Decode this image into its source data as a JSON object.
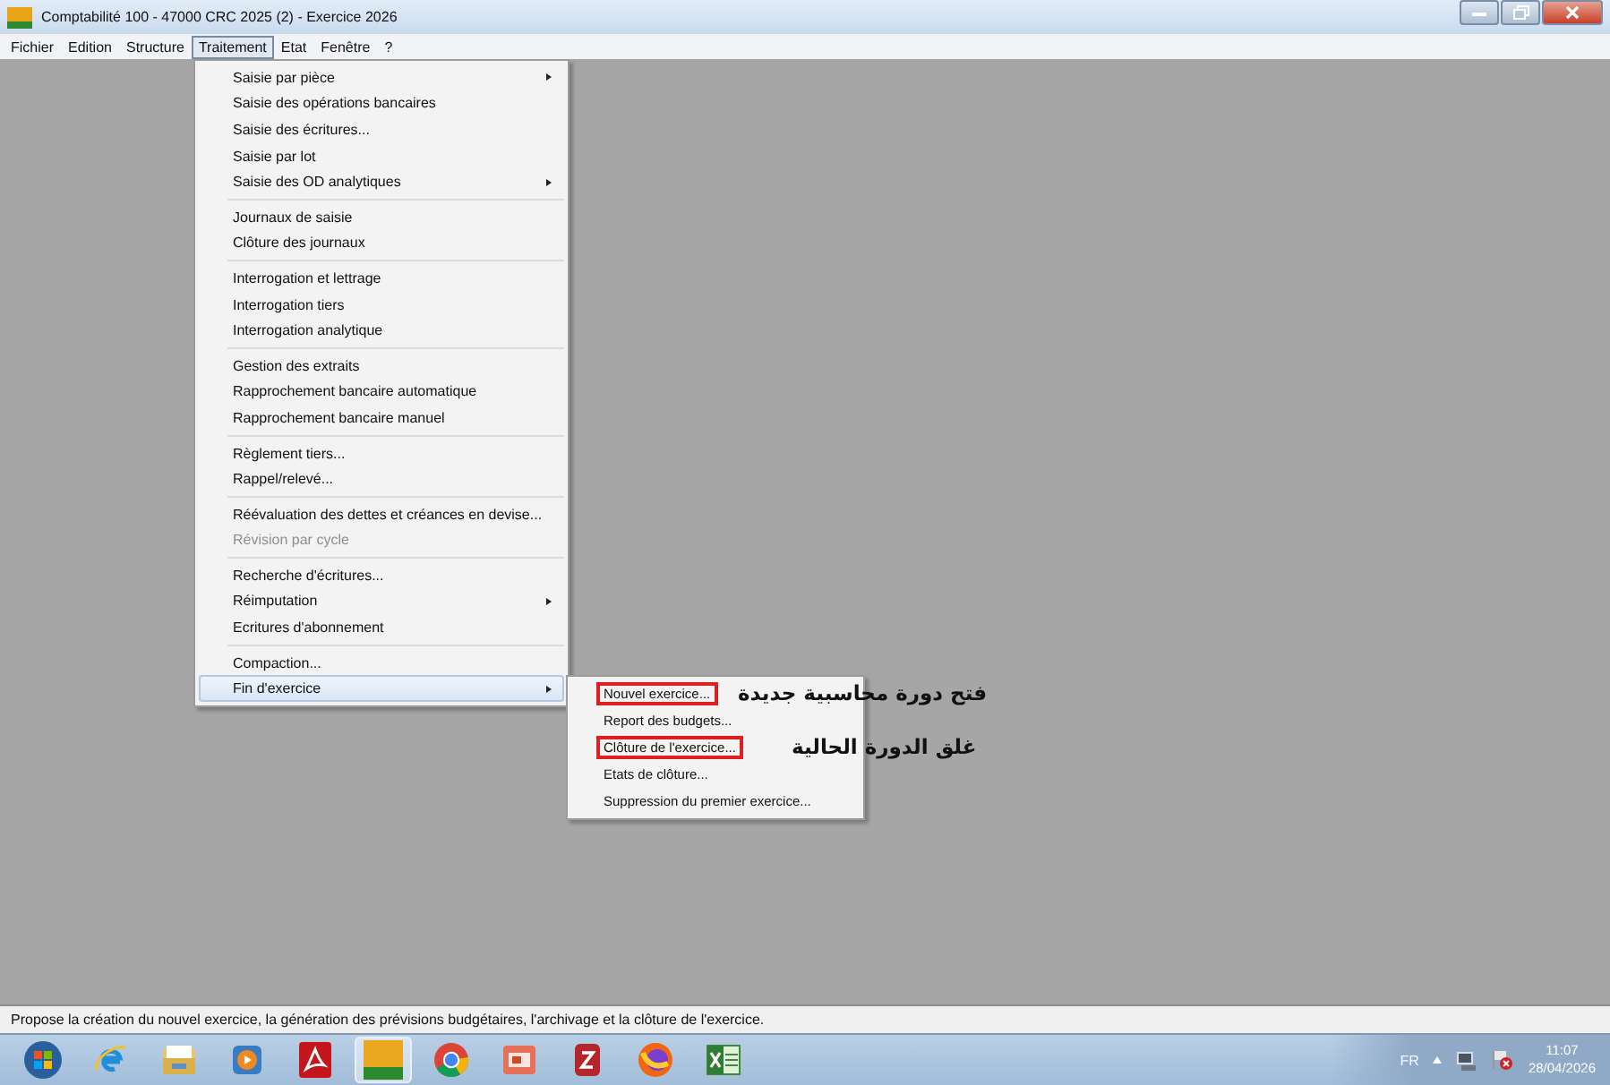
{
  "window": {
    "title": "Comptabilité 100 - 47000 CRC 2025 (2) - Exercice 2026"
  },
  "menubar": [
    {
      "label": "Fichier",
      "selected": false
    },
    {
      "label": "Edition",
      "selected": false
    },
    {
      "label": "Structure",
      "selected": false
    },
    {
      "label": "Traitement",
      "selected": true
    },
    {
      "label": "Etat",
      "selected": false
    },
    {
      "label": "Fenêtre",
      "selected": false
    },
    {
      "label": "?",
      "selected": false
    }
  ],
  "menu": [
    {
      "kind": "item",
      "label": "Saisie par pièce",
      "submenu": true,
      "disabled": false,
      "selected": false
    },
    {
      "kind": "item",
      "label": "Saisie des opérations bancaires",
      "submenu": false,
      "disabled": false,
      "selected": false
    },
    {
      "kind": "item",
      "label": "Saisie des écritures...",
      "submenu": false,
      "disabled": false,
      "selected": false
    },
    {
      "kind": "item",
      "label": "Saisie par lot",
      "submenu": false,
      "disabled": false,
      "selected": false
    },
    {
      "kind": "item",
      "label": "Saisie des OD analytiques",
      "submenu": true,
      "disabled": false,
      "selected": false
    },
    {
      "kind": "separator"
    },
    {
      "kind": "item",
      "label": "Journaux de saisie",
      "submenu": false,
      "disabled": false,
      "selected": false
    },
    {
      "kind": "item",
      "label": "Clôture des journaux",
      "submenu": false,
      "disabled": false,
      "selected": false
    },
    {
      "kind": "separator"
    },
    {
      "kind": "item",
      "label": "Interrogation et lettrage",
      "submenu": false,
      "disabled": false,
      "selected": false
    },
    {
      "kind": "item",
      "label": "Interrogation tiers",
      "submenu": false,
      "disabled": false,
      "selected": false
    },
    {
      "kind": "item",
      "label": "Interrogation analytique",
      "submenu": false,
      "disabled": false,
      "selected": false
    },
    {
      "kind": "separator"
    },
    {
      "kind": "item",
      "label": "Gestion des extraits",
      "submenu": false,
      "disabled": false,
      "selected": false
    },
    {
      "kind": "item",
      "label": "Rapprochement bancaire automatique",
      "submenu": false,
      "disabled": false,
      "selected": false
    },
    {
      "kind": "item",
      "label": "Rapprochement bancaire manuel",
      "submenu": false,
      "disabled": false,
      "selected": false
    },
    {
      "kind": "separator"
    },
    {
      "kind": "item",
      "label": "Règlement tiers...",
      "submenu": false,
      "disabled": false,
      "selected": false
    },
    {
      "kind": "item",
      "label": "Rappel/relevé...",
      "submenu": false,
      "disabled": false,
      "selected": false
    },
    {
      "kind": "separator"
    },
    {
      "kind": "item",
      "label": "Réévaluation des dettes et créances en devise...",
      "submenu": false,
      "disabled": false,
      "selected": false
    },
    {
      "kind": "item",
      "label": "Révision par cycle",
      "submenu": false,
      "disabled": true,
      "selected": false
    },
    {
      "kind": "separator"
    },
    {
      "kind": "item",
      "label": "Recherche d'écritures...",
      "submenu": false,
      "disabled": false,
      "selected": false
    },
    {
      "kind": "item",
      "label": "Réimputation",
      "submenu": true,
      "disabled": false,
      "selected": false
    },
    {
      "kind": "item",
      "label": "Ecritures d'abonnement",
      "submenu": false,
      "disabled": false,
      "selected": false
    },
    {
      "kind": "separator"
    },
    {
      "kind": "item",
      "label": "Compaction...",
      "submenu": false,
      "disabled": false,
      "selected": false
    },
    {
      "kind": "item",
      "label": "Fin d'exercice",
      "submenu": true,
      "disabled": false,
      "selected": true
    }
  ],
  "submenu": [
    {
      "label": "Nouvel exercice...",
      "outlined": true,
      "annotation": "فتح دورة محاسبية جديدة"
    },
    {
      "label": "Report des budgets...",
      "outlined": false
    },
    {
      "label": "Clôture de l'exercice...",
      "outlined": true,
      "annotation": "غلق الدورة الحالية"
    },
    {
      "label": "Etats de clôture...",
      "outlined": false
    },
    {
      "label": "Suppression du premier exercice...",
      "outlined": false
    }
  ],
  "status_bar": {
    "text": "Propose la création du nouvel exercice, la génération des prévisions budgétaires, l'archivage et la clôture de l'exercice."
  },
  "taskbar": {
    "apps": [
      {
        "kind": "start",
        "selected": false
      },
      {
        "kind": "ie",
        "selected": false
      },
      {
        "kind": "folder",
        "selected": false
      },
      {
        "kind": "media",
        "selected": false
      },
      {
        "kind": "pdf",
        "selected": false
      },
      {
        "kind": "compta",
        "selected": true
      },
      {
        "kind": "wheel",
        "selected": false
      },
      {
        "kind": "slides",
        "selected": false
      },
      {
        "kind": "z",
        "selected": false
      },
      {
        "kind": "fox",
        "selected": false
      },
      {
        "kind": "sheet",
        "selected": false
      }
    ],
    "language": "FR",
    "time": "11:07",
    "date": "28/04/2026"
  }
}
